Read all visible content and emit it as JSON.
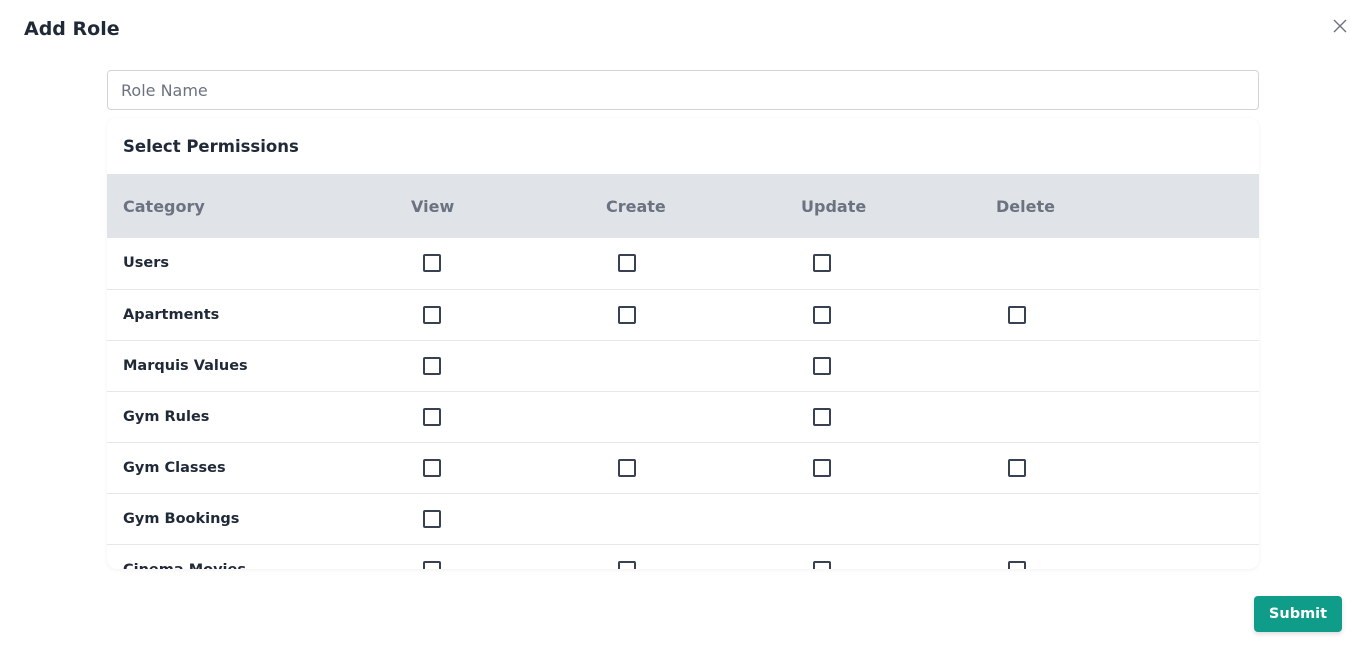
{
  "modal": {
    "title": "Add Role",
    "close_icon": "close-icon"
  },
  "role_name": {
    "placeholder": "Role Name",
    "value": ""
  },
  "permissions": {
    "title": "Select Permissions",
    "headers": [
      "Category",
      "View",
      "Create",
      "Update",
      "Delete"
    ],
    "rows": [
      {
        "category": "Users",
        "view": true,
        "create": true,
        "update": true,
        "delete": false
      },
      {
        "category": "Apartments",
        "view": true,
        "create": true,
        "update": true,
        "delete": true
      },
      {
        "category": "Marquis Values",
        "view": true,
        "create": false,
        "update": true,
        "delete": false
      },
      {
        "category": "Gym Rules",
        "view": true,
        "create": false,
        "update": true,
        "delete": false
      },
      {
        "category": "Gym Classes",
        "view": true,
        "create": true,
        "update": true,
        "delete": true
      },
      {
        "category": "Gym Bookings",
        "view": true,
        "create": false,
        "update": false,
        "delete": false
      },
      {
        "category": "Cinema Movies",
        "view": true,
        "create": true,
        "update": true,
        "delete": true
      }
    ]
  },
  "footer": {
    "submit_label": "Submit"
  },
  "colors": {
    "accent": "#0f9d8a",
    "header_bg": "#e0e3e8",
    "header_text": "#6b7280"
  }
}
